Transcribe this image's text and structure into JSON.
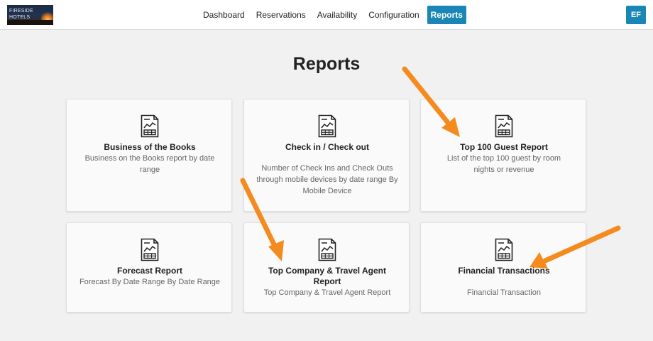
{
  "logo": {
    "text": "FIRESIDE\nHOTELS"
  },
  "nav": {
    "items": [
      {
        "label": "Dashboard"
      },
      {
        "label": "Reservations"
      },
      {
        "label": "Availability"
      },
      {
        "label": "Configuration"
      },
      {
        "label": "Reports"
      }
    ],
    "active": "Reports"
  },
  "user": {
    "initials": "EF"
  },
  "page": {
    "title": "Reports"
  },
  "cards": [
    {
      "title": "Business of the Books",
      "description": "Business on the Books report by date range"
    },
    {
      "title": "Check in / Check out",
      "description": "Number of Check Ins and Check Outs through mobile devices by date range By Mobile Device"
    },
    {
      "title": "Top 100 Guest Report",
      "description": "List of the top 100 guest by room nights or revenue"
    },
    {
      "title": "Forecast Report",
      "description": "Forecast By Date Range By Date Range"
    },
    {
      "title": "Top Company & Travel Agent Report",
      "description": "Top Company & Travel Agent Report"
    },
    {
      "title": "Financial Transactions",
      "description": "Financial Transaction"
    }
  ],
  "colors": {
    "accent": "#1a86b5",
    "annotation_arrow": "#f58a1f",
    "background": "#f1f1f1"
  },
  "icons": {
    "report": "report-document-chart-icon"
  }
}
